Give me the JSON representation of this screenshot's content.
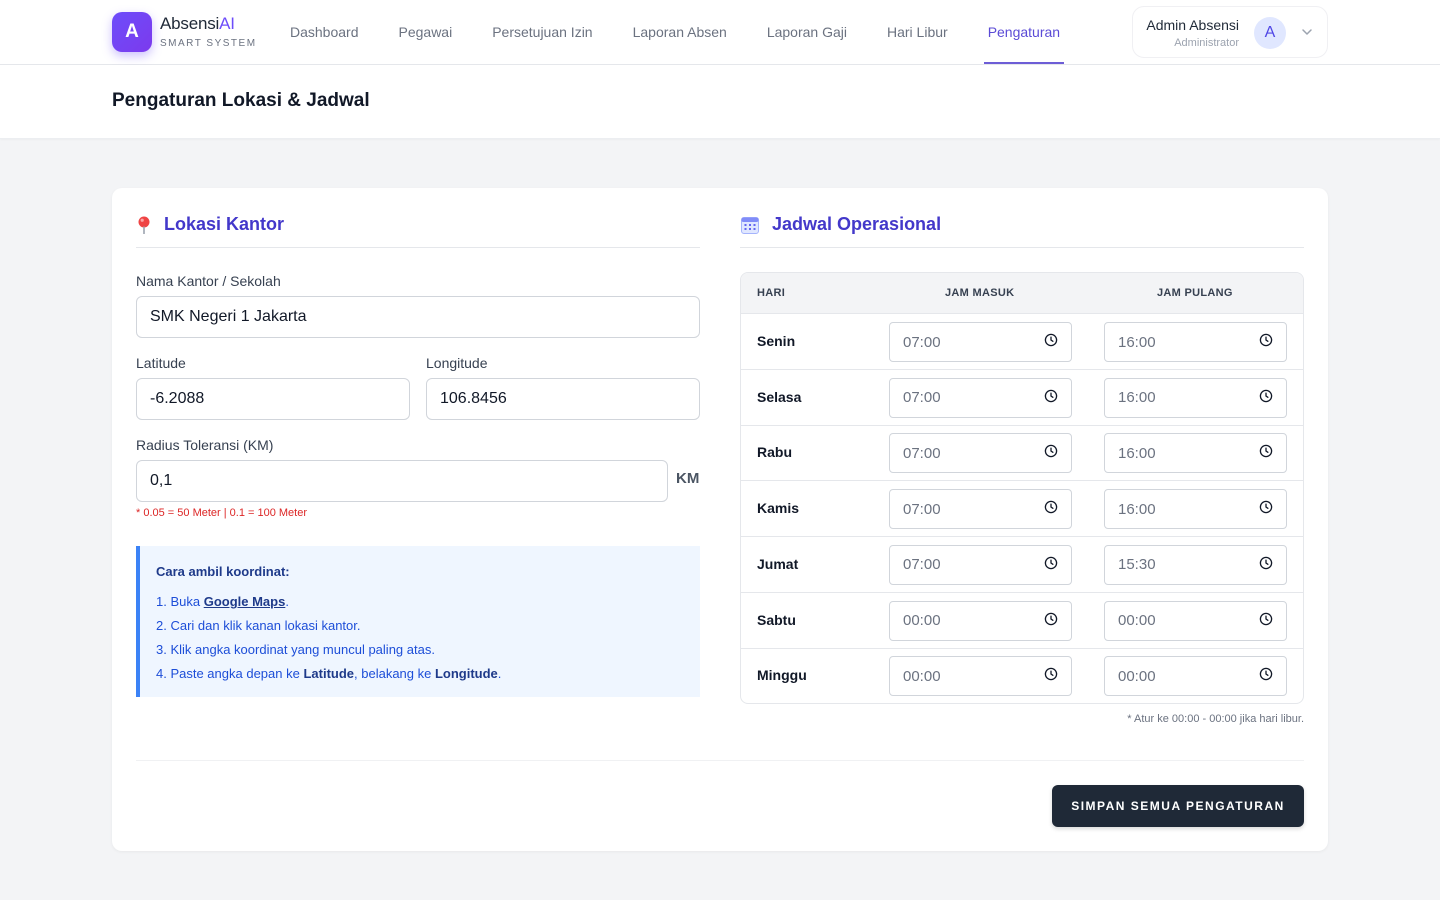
{
  "brand": {
    "logo_letter": "A",
    "name_main": "Absensi",
    "name_accent": "AI",
    "subtitle": "SMART SYSTEM"
  },
  "nav": {
    "items": [
      {
        "label": "Dashboard"
      },
      {
        "label": "Pegawai"
      },
      {
        "label": "Persetujuan Izin"
      },
      {
        "label": "Laporan Absen"
      },
      {
        "label": "Laporan Gaji"
      },
      {
        "label": "Hari Libur"
      },
      {
        "label": "Pengaturan"
      }
    ],
    "active": "Pengaturan"
  },
  "user": {
    "name": "Admin Absensi",
    "role": "Administrator",
    "avatar_letter": "A"
  },
  "page": {
    "title": "Pengaturan Lokasi & Jadwal"
  },
  "location": {
    "section_title": "Lokasi Kantor",
    "icon": "pin-icon",
    "name_label": "Nama Kantor / Sekolah",
    "name_value": "SMK Negeri 1 Jakarta",
    "lat_label": "Latitude",
    "lat_value": "-6.2088",
    "lng_label": "Longitude",
    "lng_value": "106.8456",
    "radius_label": "Radius Toleransi (KM)",
    "radius_value": "0,1",
    "radius_unit": "KM",
    "radius_hint": "* 0.05 = 50 Meter | 0.1 = 100 Meter"
  },
  "guide": {
    "title": "Cara ambil koordinat:",
    "step1_prefix": "1. Buka ",
    "step1_link": "Google Maps",
    "step1_suffix": ".",
    "step2": "2. Cari dan klik kanan lokasi kantor.",
    "step3": "3. Klik angka koordinat yang muncul paling atas.",
    "step4_prefix": "4. Paste angka depan ke ",
    "step4_lat": "Latitude",
    "step4_mid": ", belakang ke ",
    "step4_lng": "Longitude",
    "step4_suffix": "."
  },
  "schedule": {
    "section_title": "Jadwal Operasional",
    "icon": "calendar-icon",
    "headers": {
      "day": "HARI",
      "in": "JAM MASUK",
      "out": "JAM PULANG"
    },
    "rows": [
      {
        "day": "Senin",
        "in": "07:00",
        "out": "16:00"
      },
      {
        "day": "Selasa",
        "in": "07:00",
        "out": "16:00"
      },
      {
        "day": "Rabu",
        "in": "07:00",
        "out": "16:00"
      },
      {
        "day": "Kamis",
        "in": "07:00",
        "out": "16:00"
      },
      {
        "day": "Jumat",
        "in": "07:00",
        "out": "15:30"
      },
      {
        "day": "Sabtu",
        "in": "00:00",
        "out": "00:00"
      },
      {
        "day": "Minggu",
        "in": "00:00",
        "out": "00:00"
      }
    ],
    "note": "* Atur ke 00:00 - 00:00 jika hari libur."
  },
  "actions": {
    "save_label": "SIMPAN SEMUA PENGATURAN"
  },
  "colors": {
    "accent": "#4338ca",
    "brand": "#6d4dfa",
    "button": "#1f2937",
    "info_bg": "#eff6ff",
    "info_border": "#3b82f6",
    "hint": "#dc2626"
  }
}
